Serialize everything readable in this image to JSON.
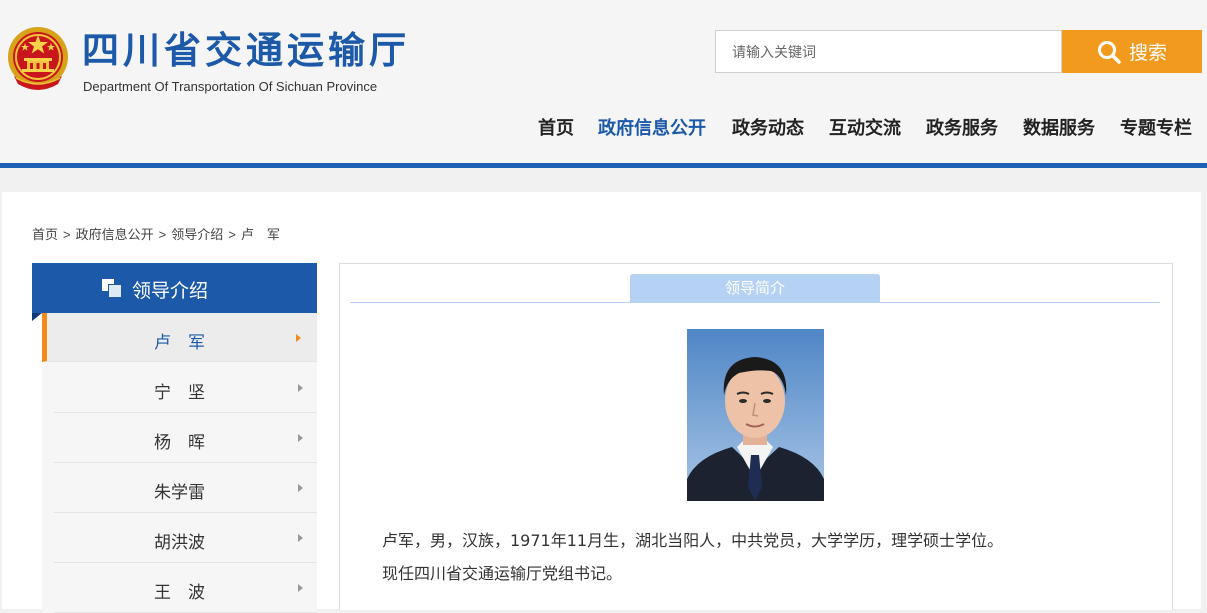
{
  "site": {
    "title": "四川省交通运输厅",
    "subtitle": "Department Of Transportation Of Sichuan Province"
  },
  "search": {
    "placeholder": "请输入关键词",
    "button_label": "搜索"
  },
  "nav": {
    "items": [
      {
        "label": "首页",
        "active": false
      },
      {
        "label": "政府信息公开",
        "active": true
      },
      {
        "label": "政务动态",
        "active": false
      },
      {
        "label": "互动交流",
        "active": false
      },
      {
        "label": "政务服务",
        "active": false
      },
      {
        "label": "数据服务",
        "active": false
      },
      {
        "label": "专题专栏",
        "active": false
      }
    ]
  },
  "breadcrumb": [
    "首页",
    "政府信息公开",
    "领导介绍",
    "卢　军"
  ],
  "breadcrumb_separator": ">",
  "sidebar": {
    "title": "领导介绍",
    "items": [
      {
        "label": "卢　军",
        "active": true
      },
      {
        "label": "宁　坚",
        "active": false
      },
      {
        "label": "杨　晖",
        "active": false
      },
      {
        "label": "朱学雷",
        "active": false
      },
      {
        "label": "胡洪波",
        "active": false
      },
      {
        "label": "王　波",
        "active": false
      }
    ]
  },
  "content": {
    "tab_label": "领导简介",
    "bio": [
      "卢军，男，汉族，1971年11月生，湖北当阳人，中共党员，大学学历，理学硕士学位。",
      "现任四川省交通运输厅党组书记。"
    ]
  },
  "colors": {
    "brand_blue": "#1c5aa9",
    "accent_orange": "#f29a1d",
    "tab_light_blue": "#b5d2f5"
  },
  "icons": {
    "emblem": "national-emblem-icon",
    "search": "search-icon",
    "sidebar_head": "overlapping-squares-icon",
    "side_arrow": "chevron-right-icon"
  }
}
